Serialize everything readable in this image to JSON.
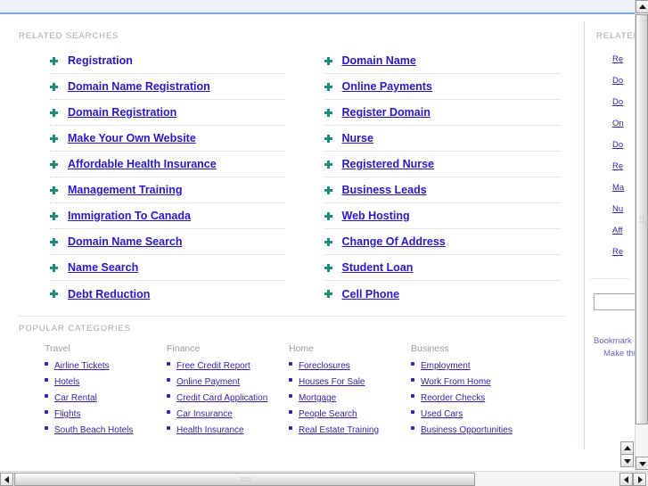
{
  "page": {
    "related_searches_label": "RELATED SEARCHES",
    "popular_categories_label": "POPULAR CATEGORIES"
  },
  "related_searches": {
    "left_column": [
      {
        "label": "Registration",
        "underline": false
      },
      {
        "label": "Domain Name Registration",
        "underline": true
      },
      {
        "label": "Domain Registration",
        "underline": true
      },
      {
        "label": "Make Your Own Website",
        "underline": true
      },
      {
        "label": "Affordable Health Insurance",
        "underline": true
      },
      {
        "label": "Management Training",
        "underline": true
      },
      {
        "label": "Immigration To Canada",
        "underline": true
      },
      {
        "label": "Domain Name Search",
        "underline": true
      },
      {
        "label": "Name Search",
        "underline": true
      },
      {
        "label": "Debt Reduction",
        "underline": true
      }
    ],
    "right_column": [
      {
        "label": "Domain Name",
        "underline": true
      },
      {
        "label": "Online Payments",
        "underline": true
      },
      {
        "label": "Register Domain",
        "underline": true
      },
      {
        "label": "Nurse",
        "underline": true
      },
      {
        "label": "Registered Nurse",
        "underline": true
      },
      {
        "label": "Business Leads",
        "underline": true
      },
      {
        "label": "Web Hosting",
        "underline": true
      },
      {
        "label": "Change Of Address",
        "underline": true
      },
      {
        "label": "Student Loan",
        "underline": true
      },
      {
        "label": "Cell Phone",
        "underline": true
      }
    ]
  },
  "popular_categories": [
    {
      "title": "Travel",
      "items": [
        "Airline Tickets",
        "Hotels",
        "Car Rental",
        "Flights",
        "South Beach Hotels"
      ]
    },
    {
      "title": "Finance",
      "items": [
        "Free Credit Report",
        "Online Payment",
        "Credit Card Application",
        "Car Insurance",
        "Health Insurance"
      ]
    },
    {
      "title": "Home",
      "items": [
        "Foreclosures",
        "Houses For Sale",
        "Mortgage",
        "People Search",
        "Real Estate Training"
      ]
    },
    {
      "title": "Business",
      "items": [
        "Employment",
        "Work From Home",
        "Reorder Checks",
        "Used Cars",
        "Business Opportunities"
      ]
    }
  ],
  "sidebar": {
    "label": "RELATED",
    "items": [
      "Re",
      "Do",
      "Do",
      "On",
      "Do",
      "Re",
      "Ma",
      "Nu",
      "Aff",
      "Re"
    ],
    "search_value": "",
    "search_placeholder": "",
    "footer_lines": [
      "Bookmark",
      "Make this"
    ]
  },
  "colors": {
    "link": "#2a18c6",
    "category_link": "#3b21a8",
    "label_gray": "#a9a9a9",
    "plus_icon": "#1f8c7a",
    "top_band": "#eef3f9",
    "top_band_border": "#7ba7d7",
    "divider": "#e2e4f3"
  }
}
